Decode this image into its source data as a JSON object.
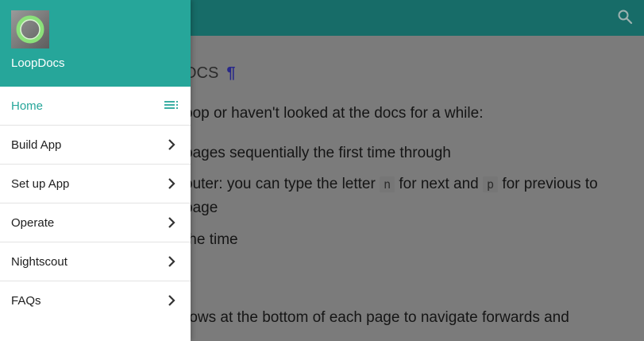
{
  "brand": {
    "name": "LoopDocs",
    "logo_icon": "loop-logo-icon"
  },
  "topbar": {
    "search_icon": "search-icon",
    "color": "#176c68"
  },
  "drawer": {
    "header_color": "#26a69a",
    "items": [
      {
        "label": "Home",
        "active": true,
        "icon": "toc-icon"
      },
      {
        "label": "Build App",
        "icon": "chevron-right-icon"
      },
      {
        "label": "Set up App",
        "icon": "chevron-right-icon"
      },
      {
        "label": "Operate",
        "icon": "chevron-right-icon"
      },
      {
        "label": "Nightscout",
        "icon": "chevron-right-icon"
      },
      {
        "label": "FAQs",
        "icon": "chevron-right-icon"
      }
    ]
  },
  "content": {
    "heading": "ocs",
    "heading_mark": "¶",
    "line1": "oop or haven't looked at the docs for a while:",
    "line2": " pages sequentially the first time through",
    "line3a": "outer: you can type the letter ",
    "code_n": "n",
    "line3b": " for next and ",
    "code_p": "p",
    "line3c": " for previous to",
    "line4": " page",
    "line5": " the time",
    "line6": ":",
    "line7": "rows at the bottom of each page to navigate forwards and"
  }
}
